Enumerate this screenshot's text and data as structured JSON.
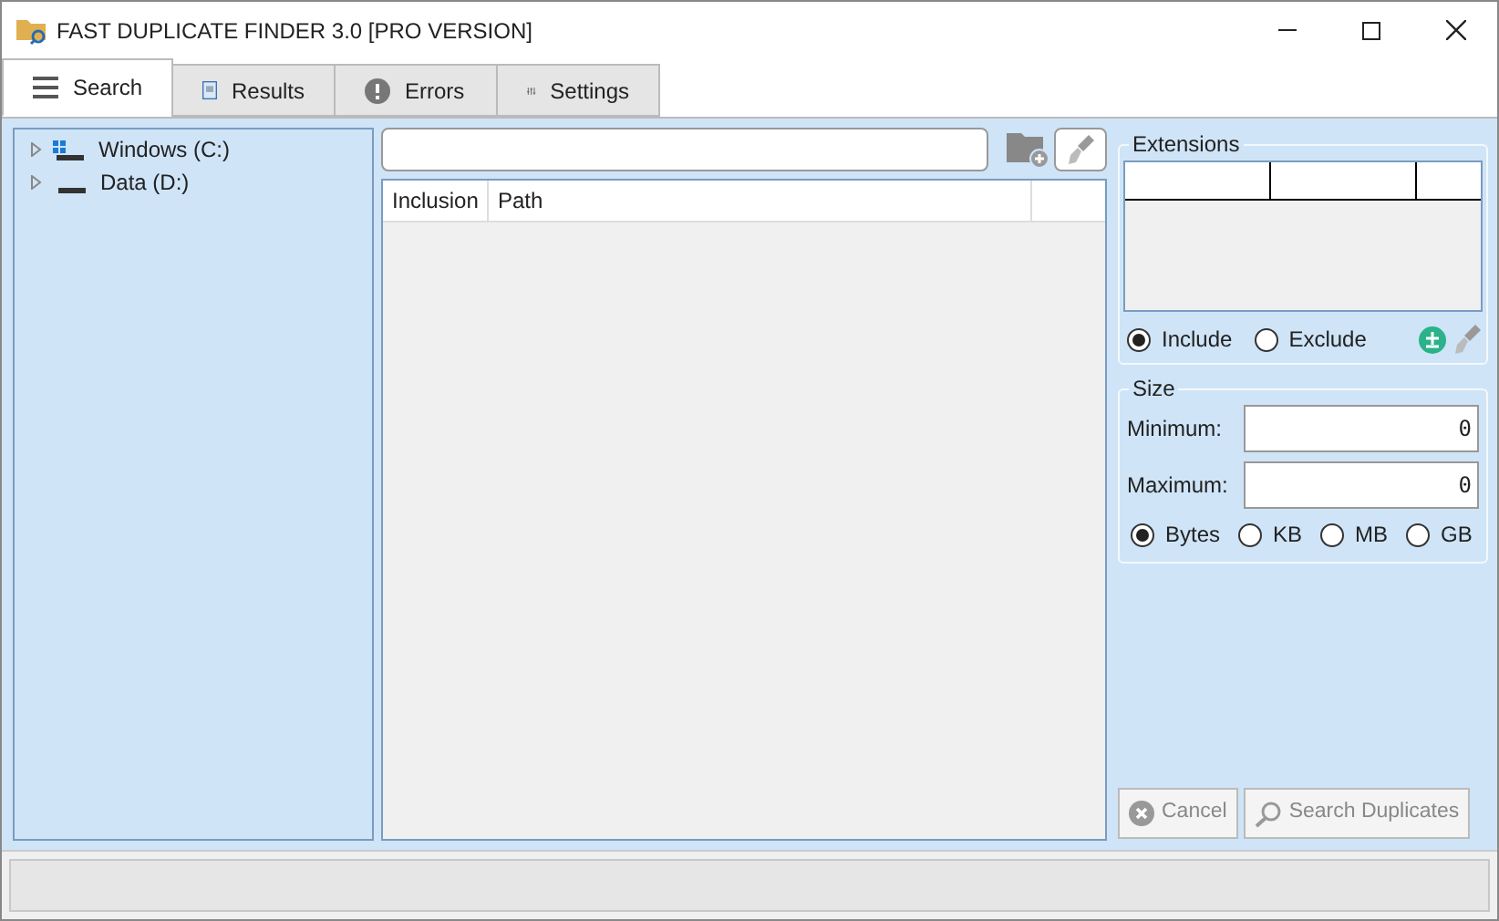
{
  "window": {
    "title": "FAST DUPLICATE FINDER 3.0 [PRO VERSION]"
  },
  "tabs": [
    {
      "label": "Search",
      "kind": "menu",
      "selected": true
    },
    {
      "label": "Results",
      "kind": "notebook",
      "selected": false
    },
    {
      "label": "Errors",
      "kind": "alert",
      "selected": false
    },
    {
      "label": "Settings",
      "kind": "sliders",
      "selected": false
    }
  ],
  "drives": [
    {
      "label": "Windows (C:)",
      "kind": "system",
      "expanded": false
    },
    {
      "label": "Data (D:)",
      "kind": "data",
      "expanded": false
    }
  ],
  "paths_table": {
    "columns": [
      "Inclusion",
      "Path"
    ]
  },
  "extensions": {
    "title": "Extensions",
    "modes": [
      {
        "label": "Include",
        "selected": true
      },
      {
        "label": "Exclude",
        "selected": false
      }
    ]
  },
  "size": {
    "title": "Size",
    "fields": [
      {
        "label": "Minimum:",
        "value": "0"
      },
      {
        "label": "Maximum:",
        "value": "0"
      }
    ],
    "units": [
      {
        "label": "Bytes",
        "selected": true
      },
      {
        "label": "KB",
        "selected": false
      },
      {
        "label": "MB",
        "selected": false
      },
      {
        "label": "GB",
        "selected": false
      }
    ]
  },
  "buttons": [
    {
      "label": "Cancel",
      "kind": "cancel",
      "disabled": true
    },
    {
      "label": "Search Duplicates",
      "kind": "search",
      "disabled": true
    }
  ]
}
